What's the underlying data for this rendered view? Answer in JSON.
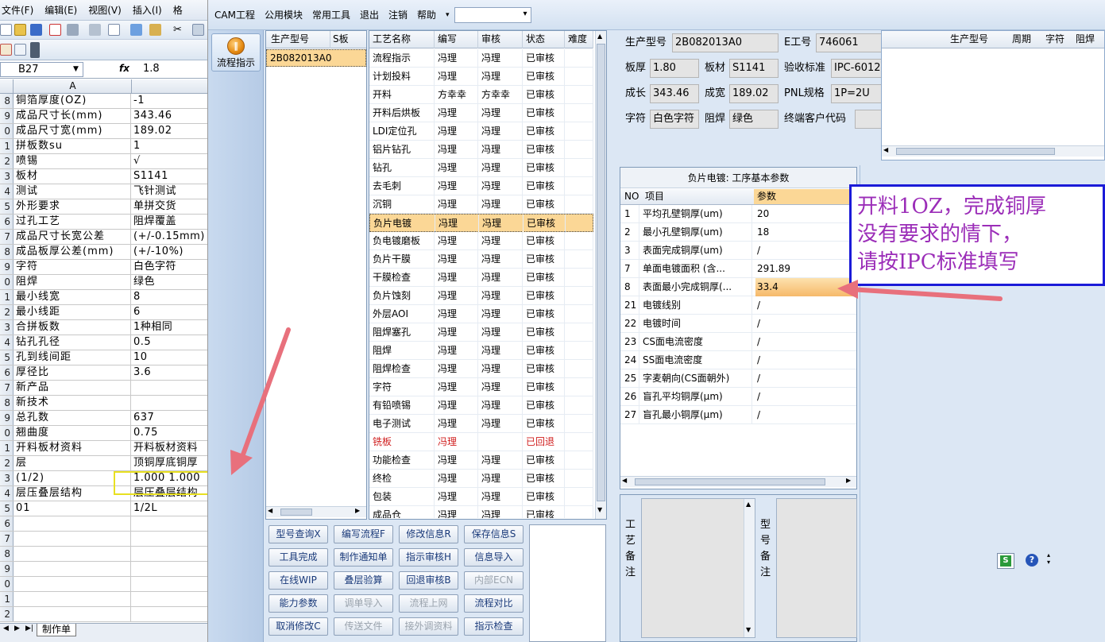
{
  "excel": {
    "menu": [
      "文件(F)",
      "编辑(E)",
      "视图(V)",
      "插入(I)",
      "格"
    ],
    "name_box": "B27",
    "fx_label": "fx",
    "formula_value": "1.8",
    "col_header": "A",
    "rows": [
      {
        "num": "8",
        "a": "铜箔厚度(OZ)",
        "b": "-1"
      },
      {
        "num": "9",
        "a": "成品尺寸长(mm)",
        "b": "343.46"
      },
      {
        "num": "0",
        "a": "成品尺寸宽(mm)",
        "b": "189.02"
      },
      {
        "num": "1",
        "a": "拼板数su",
        "b": "1"
      },
      {
        "num": "2",
        "a": "喷锡",
        "b": "√"
      },
      {
        "num": "3",
        "a": "板材",
        "b": "S1141"
      },
      {
        "num": "4",
        "a": "测试",
        "b": "飞针测试"
      },
      {
        "num": "5",
        "a": "外形要求",
        "b": "单拼交货"
      },
      {
        "num": "6",
        "a": "过孔工艺",
        "b": "阻焊覆盖"
      },
      {
        "num": "7",
        "a": "成品尺寸长宽公差",
        "b": "(+/-0.15mm)"
      },
      {
        "num": "8",
        "a": "成品板厚公差(mm)",
        "b": "(+/-10%)"
      },
      {
        "num": "9",
        "a": "字符",
        "b": "白色字符"
      },
      {
        "num": "0",
        "a": "阻焊",
        "b": "绿色"
      },
      {
        "num": "1",
        "a": "最小线宽",
        "b": "8"
      },
      {
        "num": "2",
        "a": "最小线距",
        "b": "6"
      },
      {
        "num": "3",
        "a": "合拼板数",
        "b": "1种相同"
      },
      {
        "num": "4",
        "a": "钻孔孔径",
        "b": "0.5"
      },
      {
        "num": "5",
        "a": "孔到线间距",
        "b": "10"
      },
      {
        "num": "6",
        "a": "厚径比",
        "b": "3.6"
      },
      {
        "num": "7",
        "a": "新产品",
        "b": ""
      },
      {
        "num": "8",
        "a": "新技术",
        "b": ""
      },
      {
        "num": "9",
        "a": "总孔数",
        "b": "637"
      },
      {
        "num": "0",
        "a": "翘曲度",
        "b": "0.75"
      },
      {
        "num": "1",
        "a": "开料板材资料",
        "b": "开料板材资料"
      },
      {
        "num": "2",
        "a": "层",
        "b": "顶铜厚底铜厚"
      },
      {
        "num": "3",
        "a": "(1/2)",
        "b": "1.000  1.000"
      },
      {
        "num": "4",
        "a": "层压叠层结构",
        "b": "层压叠层结构"
      },
      {
        "num": "5",
        "a": "01",
        "b": "1/2L"
      },
      {
        "num": "6",
        "a": "",
        "b": ""
      },
      {
        "num": "7",
        "a": "",
        "b": ""
      },
      {
        "num": "8",
        "a": "",
        "b": ""
      },
      {
        "num": "9",
        "a": "",
        "b": ""
      },
      {
        "num": "0",
        "a": "",
        "b": ""
      },
      {
        "num": "1",
        "a": "",
        "b": ""
      },
      {
        "num": "2",
        "a": "",
        "b": ""
      }
    ],
    "sheet_tab": "制作单"
  },
  "cam": {
    "menu": [
      "CAM工程",
      "公用模块",
      "常用工具",
      "退出",
      "注销",
      "帮助"
    ],
    "side_button": "流程指示",
    "model_grid": {
      "headers": [
        "生产型号",
        "S板"
      ],
      "rows": [
        {
          "model": "2B082013A0",
          "s": ""
        }
      ]
    },
    "process_grid": {
      "headers": [
        "工艺名称",
        "编写",
        "审核",
        "状态",
        "难度"
      ],
      "rows": [
        {
          "name": "流程指示",
          "writer": "冯理",
          "reviewer": "冯理",
          "status": "已审核"
        },
        {
          "name": "计划投料",
          "writer": "冯理",
          "reviewer": "冯理",
          "status": "已审核"
        },
        {
          "name": "开料",
          "writer": "方幸幸",
          "reviewer": "方幸幸",
          "status": "已审核"
        },
        {
          "name": "开料后烘板",
          "writer": "冯理",
          "reviewer": "冯理",
          "status": "已审核"
        },
        {
          "name": "LDI定位孔",
          "writer": "冯理",
          "reviewer": "冯理",
          "status": "已审核"
        },
        {
          "name": "铝片钻孔",
          "writer": "冯理",
          "reviewer": "冯理",
          "status": "已审核"
        },
        {
          "name": "钻孔",
          "writer": "冯理",
          "reviewer": "冯理",
          "status": "已审核"
        },
        {
          "name": "去毛刺",
          "writer": "冯理",
          "reviewer": "冯理",
          "status": "已审核"
        },
        {
          "name": "沉铜",
          "writer": "冯理",
          "reviewer": "冯理",
          "status": "已审核"
        },
        {
          "name": "负片电镀",
          "writer": "冯理",
          "reviewer": "冯理",
          "status": "已审核"
        },
        {
          "name": "负电镀磨板",
          "writer": "冯理",
          "reviewer": "冯理",
          "status": "已审核"
        },
        {
          "name": "负片干膜",
          "writer": "冯理",
          "reviewer": "冯理",
          "status": "已审核"
        },
        {
          "name": "干膜检查",
          "writer": "冯理",
          "reviewer": "冯理",
          "status": "已审核"
        },
        {
          "name": "负片蚀刻",
          "writer": "冯理",
          "reviewer": "冯理",
          "status": "已审核"
        },
        {
          "name": "外层AOI",
          "writer": "冯理",
          "reviewer": "冯理",
          "status": "已审核"
        },
        {
          "name": "阻焊塞孔",
          "writer": "冯理",
          "reviewer": "冯理",
          "status": "已审核"
        },
        {
          "name": "阻焊",
          "writer": "冯理",
          "reviewer": "冯理",
          "status": "已审核"
        },
        {
          "name": "阻焊检查",
          "writer": "冯理",
          "reviewer": "冯理",
          "status": "已审核"
        },
        {
          "name": "字符",
          "writer": "冯理",
          "reviewer": "冯理",
          "status": "已审核"
        },
        {
          "name": "有铅喷锡",
          "writer": "冯理",
          "reviewer": "冯理",
          "status": "已审核"
        },
        {
          "name": "电子测试",
          "writer": "冯理",
          "reviewer": "冯理",
          "status": "已审核"
        },
        {
          "name": "铣板",
          "writer": "冯理",
          "reviewer": "",
          "status": "已回退"
        },
        {
          "name": "功能检查",
          "writer": "冯理",
          "reviewer": "冯理",
          "status": "已审核"
        },
        {
          "name": "终检",
          "writer": "冯理",
          "reviewer": "冯理",
          "status": "已审核"
        },
        {
          "name": "包装",
          "writer": "冯理",
          "reviewer": "冯理",
          "status": "已审核"
        },
        {
          "name": "成品仓",
          "writer": "冯理",
          "reviewer": "冯理",
          "status": "已审核"
        }
      ]
    },
    "buttons": [
      [
        "型号查询X",
        "编写流程F",
        "修改信息R",
        "保存信息S"
      ],
      [
        "工具完成",
        "制作通知单",
        "指示审核H",
        "信息导入"
      ],
      [
        "在线WIP",
        "叠层验算",
        "回退审核B",
        "内部ECN"
      ],
      [
        "能力参数",
        "调单导入",
        "流程上网",
        "流程对比"
      ],
      [
        "取消修改C",
        "传送文件",
        "接外调资料",
        "指示检查"
      ]
    ],
    "info": {
      "model_label": "生产型号",
      "model": "2B082013A0",
      "e_label": "E工号",
      "e_no": "746061",
      "thick_label": "板厚",
      "thick": "1.80",
      "material_label": "板材",
      "material": "S1141",
      "std_label": "验收标准",
      "std": "IPC-6012",
      "len_label": "成长",
      "len": "343.46",
      "wid_label": "成宽",
      "wid": "189.02",
      "pnl_label": "PNL规格",
      "pnl": "1P=2U",
      "char_label": "字符",
      "char": "白色字符",
      "mask_label": "阻焊",
      "mask": "绿色",
      "cust_label": "终端客户代码",
      "cust": ""
    },
    "right_grid_headers": [
      "生产型号",
      "周期",
      "字符",
      "阻焊"
    ],
    "params": {
      "title": "负片电镀: 工序基本参数",
      "headers": [
        "NO",
        "项目",
        "参数"
      ],
      "rows": [
        {
          "no": "1",
          "item": "平均孔壁铜厚(um)",
          "val": "20"
        },
        {
          "no": "2",
          "item": "最小孔壁铜厚(um)",
          "val": "18"
        },
        {
          "no": "3",
          "item": "表面完成铜厚(um)",
          "val": "/"
        },
        {
          "no": "7",
          "item": "单面电镀面积 (含...",
          "val": "291.89"
        },
        {
          "no": "8",
          "item": "表面最小完成铜厚(...",
          "val": "33.4"
        },
        {
          "no": "21",
          "item": "电镀线别",
          "val": "/"
        },
        {
          "no": "22",
          "item": "电镀时间",
          "val": "/"
        },
        {
          "no": "23",
          "item": "CS面电流密度",
          "val": "/"
        },
        {
          "no": "24",
          "item": "SS面电流密度",
          "val": "/"
        },
        {
          "no": "25",
          "item": "字麦朝向(CS面朝外)",
          "val": "/"
        },
        {
          "no": "26",
          "item": "盲孔平均铜厚(μm)",
          "val": "/"
        },
        {
          "no": "27",
          "item": "盲孔最小铜厚(μm)",
          "val": "/"
        }
      ]
    },
    "notes": {
      "process_label": "工艺备注",
      "model_label": "型号备注"
    },
    "callout": [
      "开料1OZ，完成铜厚",
      "没有要求的情下，",
      "请按IPC标准填写"
    ]
  },
  "colors": {
    "selected_row": "#fbd796",
    "callout_text": "#9b2db8",
    "callout_border": "#1b1bd8",
    "arrow": "#e8707c",
    "highlight_box": "#e8e021",
    "returned": "#d02020"
  }
}
